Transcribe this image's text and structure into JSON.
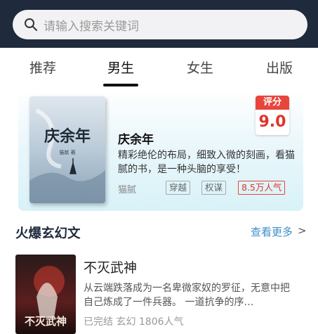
{
  "search": {
    "placeholder": "请输入搜索关键词",
    "icon": "search-icon"
  },
  "tabs": [
    {
      "label": "推荐",
      "active": false
    },
    {
      "label": "男生",
      "active": true
    },
    {
      "label": "女生",
      "active": false
    },
    {
      "label": "出版",
      "active": false
    }
  ],
  "featured": {
    "cover_title": "庆余年",
    "cover_author": "猫腻 著",
    "score_label": "评分",
    "score": "9.0",
    "title": "庆余年",
    "description": "精彩绝伦的布局，细致入微的刻画，看猫腻的书，是一种头脑的享受！",
    "author": "猫腻",
    "tags": [
      "穿越",
      "权谋"
    ],
    "popularity": "8.5万人气",
    "colors": {
      "accent": "#e8453c"
    }
  },
  "section": {
    "title": "火爆玄幻文",
    "more_label": "查看更多",
    "more_arrow": ">"
  },
  "books": [
    {
      "cover_title": "不灭武神",
      "title": "不灭武神",
      "description": "从云端跌落成为一名卑微家奴的罗征，无意中把自己炼成了一件兵器。 一道抗争的序…",
      "meta": "已完结 玄幻 1806人气"
    }
  ],
  "colors": {
    "top_bar": "#1f2b3c",
    "link": "#3b8ec8"
  }
}
